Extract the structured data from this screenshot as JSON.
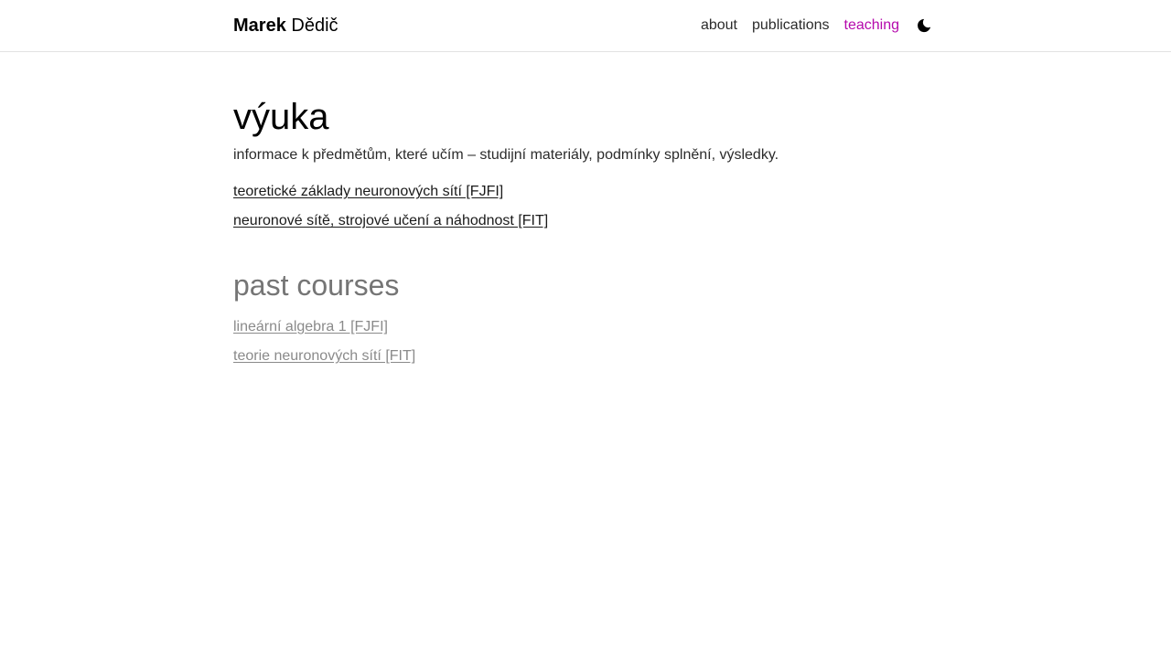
{
  "header": {
    "brand_first": "Marek",
    "brand_last": "Dědič",
    "nav": [
      {
        "label": "about",
        "active": false
      },
      {
        "label": "publications",
        "active": false
      },
      {
        "label": "teaching",
        "active": true
      }
    ],
    "theme_toggle_icon": "moon-icon",
    "accent_color": "#b509ac"
  },
  "main": {
    "title": "výuka",
    "description": "informace k předmětům, které učím – studijní materiály, podmínky splnění, výsledky.",
    "current_courses": [
      {
        "label": "teoretické základy neuronových sítí [FJFI]"
      },
      {
        "label": "neuronové sítě, strojové učení a náhodnost [FIT]"
      }
    ],
    "past_title": "past courses",
    "past_courses": [
      {
        "label": "lineární algebra 1 [FJFI]"
      },
      {
        "label": "teorie neuronových sítí [FIT]"
      }
    ]
  }
}
